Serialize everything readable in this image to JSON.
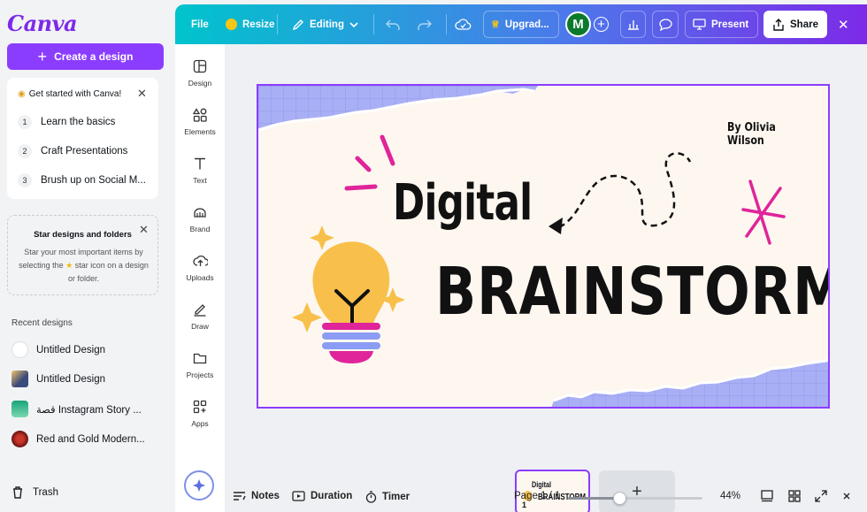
{
  "app": {
    "logo": "Canva"
  },
  "sidebar": {
    "create_label": "Create a design",
    "getting_started": {
      "title": "Get started with Canva!",
      "items": [
        {
          "num": "1",
          "label": "Learn the basics"
        },
        {
          "num": "2",
          "label": "Craft Presentations"
        },
        {
          "num": "3",
          "label": "Brush up on Social M..."
        }
      ]
    },
    "star_box": {
      "title": "Star designs and folders",
      "body_1": "Star your most important items by selecting the",
      "body_2": "star icon on a design or folder."
    },
    "recent_label": "Recent designs",
    "recent": [
      {
        "label": "Untitled Design",
        "thumb_color": "#ffffff"
      },
      {
        "label": "Untitled Design",
        "thumb_color": "#3a4a7a"
      },
      {
        "label": "قصة Instagram Story ...",
        "thumb_color": "#1aa37a"
      },
      {
        "label": "Red and Gold Modern...",
        "thumb_color": "#7a1010"
      }
    ],
    "trash_label": "Trash"
  },
  "topbar": {
    "file": "File",
    "resize": "Resize",
    "editing": "Editing",
    "upgrade": "Upgrad...",
    "avatar_initial": "M",
    "present": "Present",
    "share": "Share"
  },
  "tools": [
    {
      "label": "Design",
      "icon": "layout-icon"
    },
    {
      "label": "Elements",
      "icon": "shapes-icon"
    },
    {
      "label": "Text",
      "icon": "text-icon"
    },
    {
      "label": "Brand",
      "icon": "brand-icon"
    },
    {
      "label": "Uploads",
      "icon": "cloud-upload-icon"
    },
    {
      "label": "Draw",
      "icon": "pen-icon"
    },
    {
      "label": "Projects",
      "icon": "folder-icon"
    },
    {
      "label": "Apps",
      "icon": "apps-icon"
    }
  ],
  "design": {
    "author": "By Olivia Wilson",
    "title": "Digital",
    "subtitle": "BRAINSTORM",
    "accent_color": "#e0249a",
    "paper_color": "#a9aff5"
  },
  "page_strip": {
    "thumb_title": "Digital",
    "thumb_subtitle": "BRAINSTORM",
    "thumb_number": "1",
    "add_page": "+"
  },
  "bottombar": {
    "notes": "Notes",
    "duration": "Duration",
    "timer": "Timer",
    "page_indicator": "Page 1 / 1",
    "zoom": "44%",
    "zoom_fraction": 0.38
  },
  "colors": {
    "brand_purple": "#8b3dff",
    "gradient_start": "#00c4cc",
    "gradient_end": "#7d2ae8"
  }
}
